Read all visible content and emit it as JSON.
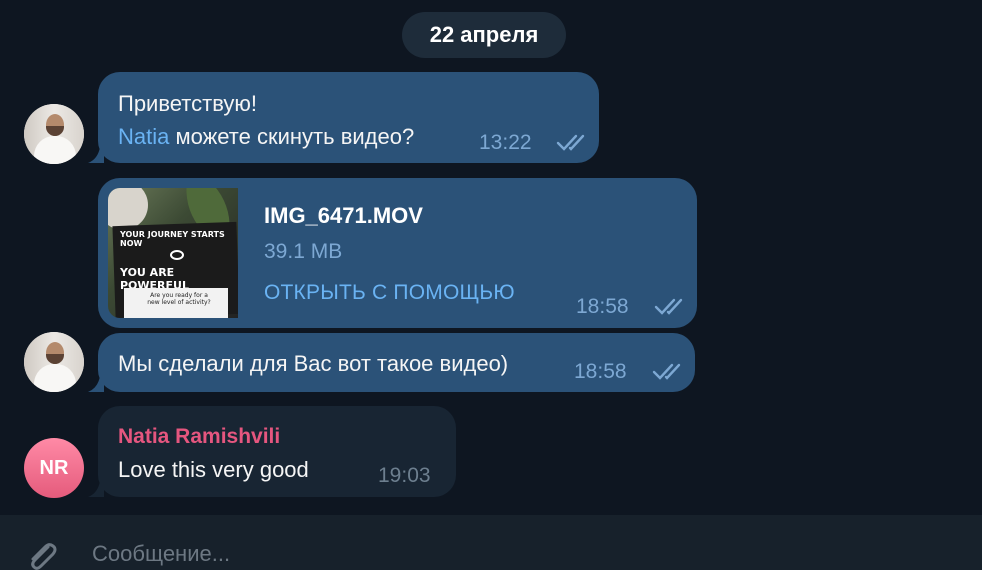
{
  "date_separator": "22 апреля",
  "messages": [
    {
      "line1": "Приветствую!",
      "mention": "Natia",
      "line2": " можете скинуть видео?",
      "time": "13:22"
    },
    {
      "file_name": "IMG_6471.MOV",
      "file_size": "39.1 MB",
      "open_with": "ОТКРЫТЬ С ПОМОЩЬЮ",
      "time": "18:58",
      "thumb_line1": "YOUR JOURNEY STARTS NOW",
      "thumb_line2": "YOU ARE POWERFUL",
      "thumb_line3": "Are you ready for a new level of activity?"
    },
    {
      "text": "Мы сделали для Вас вот такое видео)",
      "time": "18:58"
    },
    {
      "sender": "Natia Ramishvili",
      "text": "Love this very good",
      "time": "19:03",
      "avatar_initials": "NR"
    }
  ],
  "composer": {
    "placeholder": "Сообщение..."
  },
  "icons": {
    "read_receipt": "double-check-icon",
    "attach": "paperclip-icon"
  },
  "colors": {
    "background": "#0e1621",
    "outgoing_bubble": "#2b5278",
    "incoming_bubble": "#182533",
    "accent": "#6ab3f3",
    "sender_name": "#e5567f"
  }
}
